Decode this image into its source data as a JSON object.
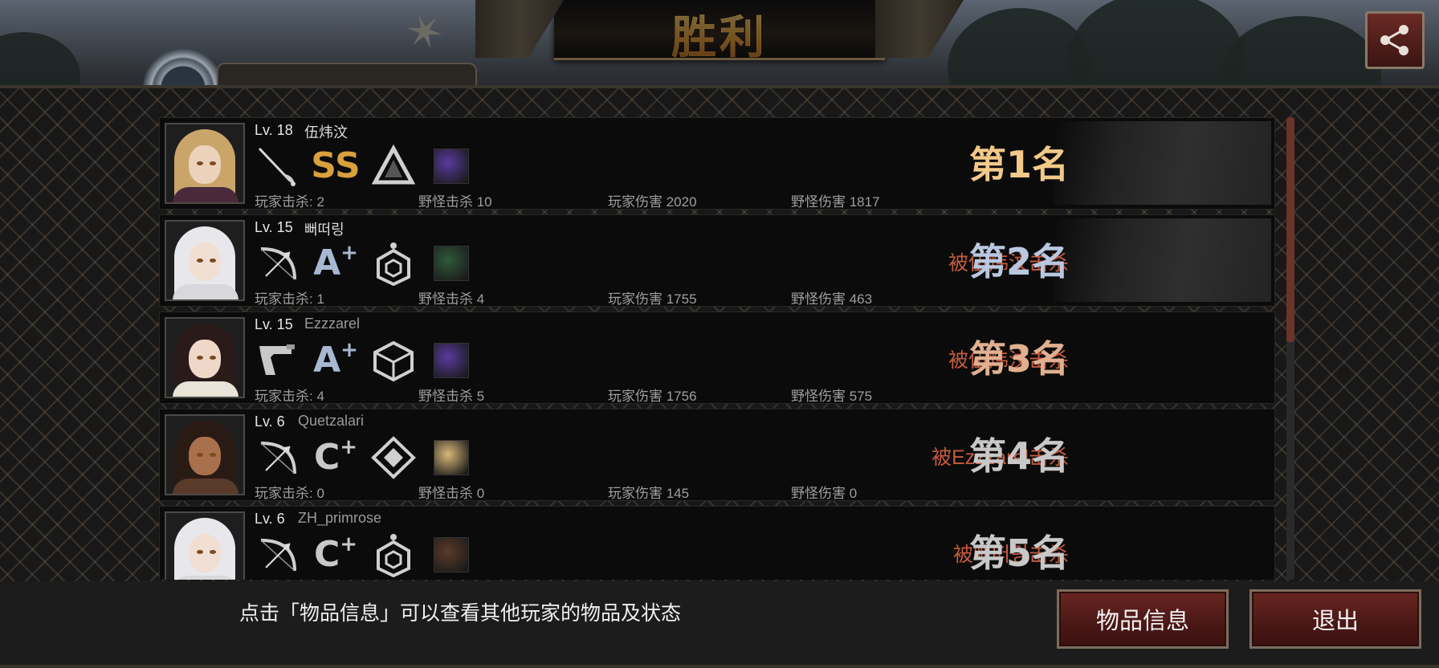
{
  "header": {
    "title": "胜利",
    "share_icon": "share-icon",
    "colors": {
      "title_gold": "#f0c060",
      "kill_red": "#c55a3e",
      "button_red": "#4a1715"
    }
  },
  "players": [
    {
      "level": "Lv. 18",
      "name": "伍炜汶",
      "name_dim": false,
      "weapon_icon": "rapier-icon",
      "grade": "SS",
      "grade_plus": "",
      "grade_color": "#d9a03c",
      "class_icon": "triangle-emblem-icon",
      "item_icon": "purple-crystal-icon",
      "item_color": "#5a3aa0",
      "stats": {
        "player_kills": "玩家击杀: 2",
        "monster_kills": "野怪击杀 10",
        "player_damage": "玩家伤害 2020",
        "monster_damage": "野怪伤害 1817"
      },
      "killed_by": "",
      "rank": "第1名",
      "rank_color": "#f2c98a",
      "avatar": {
        "hair": "#c9a56a",
        "skin": "#ecd2bb",
        "body": "#4a2a3a"
      }
    },
    {
      "level": "Lv. 15",
      "name": "뻐떠링",
      "name_dim": false,
      "weapon_icon": "bow-icon",
      "grade": "A",
      "grade_plus": "+",
      "grade_color": "#a9b8d2",
      "class_icon": "hexagon-emblem-icon",
      "item_icon": "green-creature-icon",
      "item_color": "#2f5a3a",
      "stats": {
        "player_kills": "玩家击杀: 1",
        "monster_kills": "野怪击杀 4",
        "player_damage": "玩家伤害 1755",
        "monster_damage": "野怪伤害 463"
      },
      "killed_by": "被伍炜汶击杀",
      "rank": "第2名",
      "rank_color": "#b9c8e0",
      "avatar": {
        "hair": "#e8e8ec",
        "skin": "#f1dfd3",
        "body": "#d8d8dc"
      }
    },
    {
      "level": "Lv. 15",
      "name": "Ezzzarel",
      "name_dim": true,
      "weapon_icon": "pistol-icon",
      "grade": "A",
      "grade_plus": "+",
      "grade_color": "#a9b8d2",
      "class_icon": "cube-emblem-icon",
      "item_icon": "purple-crystal-icon",
      "item_color": "#5a3aa0",
      "stats": {
        "player_kills": "玩家击杀: 4",
        "monster_kills": "野怪击杀 5",
        "player_damage": "玩家伤害 1756",
        "monster_damage": "野怪伤害 575"
      },
      "killed_by": "被伍炜汶击杀",
      "rank": "第3名",
      "rank_color": "#e0b090",
      "avatar": {
        "hair": "#2a1a1a",
        "skin": "#f0d8c8",
        "body": "#e8e4d8"
      }
    },
    {
      "level": "Lv. 6",
      "name": "Quetzalari",
      "name_dim": true,
      "weapon_icon": "bow-icon",
      "grade": "C",
      "grade_plus": "+",
      "grade_color": "#c8c8c8",
      "class_icon": "diamond-emblem-icon",
      "item_icon": "parchment-icon",
      "item_color": "#d8b878",
      "stats": {
        "player_kills": "玩家击杀: 0",
        "monster_kills": "野怪击杀 0",
        "player_damage": "玩家伤害 145",
        "monster_damage": "野怪伤害 0"
      },
      "killed_by": "被Ezzzarel击杀",
      "rank": "第4名",
      "rank_color": "#c8c8c8",
      "avatar": {
        "hair": "#2a1a14",
        "skin": "#a8704c",
        "body": "#5a3a2a"
      }
    },
    {
      "level": "Lv. 6",
      "name": "ZH_primrose",
      "name_dim": true,
      "weapon_icon": "bow-icon",
      "grade": "C",
      "grade_plus": "+",
      "grade_color": "#c8c8c8",
      "class_icon": "hexagon-emblem-icon",
      "item_icon": "crossed-blades-icon",
      "item_color": "#5a3a28",
      "stats": {
        "player_kills": "",
        "monster_kills": "",
        "player_damage": "",
        "monster_damage": ""
      },
      "killed_by": "被뻐떠링击杀",
      "rank": "第5名",
      "rank_color": "#c8c8c8",
      "avatar": {
        "hair": "#e8e8ec",
        "skin": "#f1dfd3",
        "body": "#d8d8dc"
      }
    }
  ],
  "footer": {
    "hint": "点击「物品信息」可以查看其他玩家的物品及状态",
    "items_button": "物品信息",
    "exit_button": "退出"
  }
}
